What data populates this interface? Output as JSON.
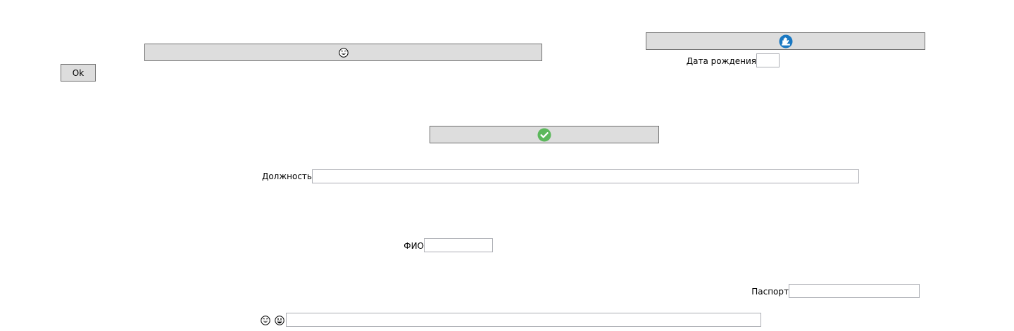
{
  "buttons": {
    "ok_label": "Ok",
    "laugh_icon": "laughing-face-icon",
    "hand_icon": "raised-hand-icon",
    "check_icon": "check-circle-icon"
  },
  "fields": {
    "birth_date": {
      "label": "Дата рождения",
      "value": ""
    },
    "position": {
      "label": "Должность",
      "value": ""
    },
    "fio": {
      "label": "ФИО",
      "value": ""
    },
    "passport": {
      "label": "Паспорт",
      "value": ""
    },
    "emoji_field": {
      "value": "",
      "icons": [
        "laughing-face-icon",
        "grinning-face-icon"
      ]
    }
  },
  "colors": {
    "button_face": "#dddddd",
    "button_border": "#707070",
    "field_border": "#abadb3",
    "check_green": "#5cb85c",
    "hand_blue": "#1a78c2"
  }
}
